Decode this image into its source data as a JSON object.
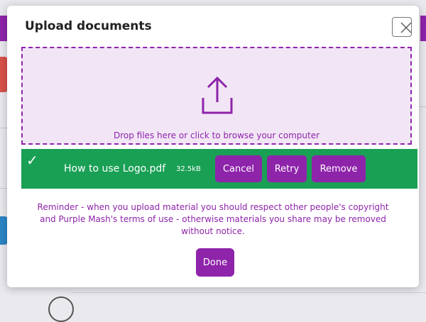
{
  "modal": {
    "title": "Upload documents",
    "close_icon": "close-x-icon"
  },
  "dropzone": {
    "icon": "upload-icon",
    "text": "Drop files here or click to browse your computer"
  },
  "file": {
    "status_icon": "checkmark-icon",
    "check_glyph": "✓",
    "name": "How to use Logo.pdf",
    "size": "32.5kB",
    "cancel_label": "Cancel",
    "retry_label": "Retry",
    "remove_label": "Remove"
  },
  "reminder": "Reminder - when you upload material you should respect other people's copyright and Purple Mash's terms of use - otherwise materials you share may be removed without notice.",
  "done_label": "Done",
  "colors": {
    "accent": "#8e24aa",
    "success": "#1aa055",
    "dropzone_bg": "#f2e6f6"
  }
}
